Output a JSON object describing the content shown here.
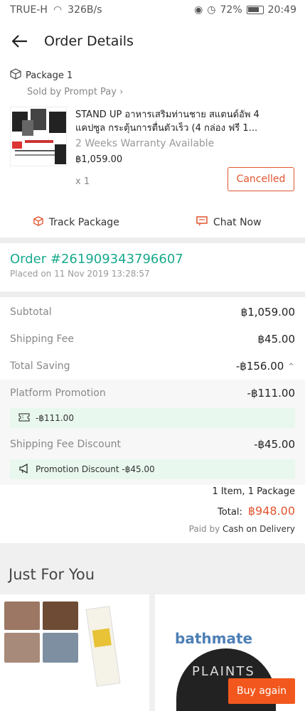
{
  "status": {
    "carrier": "TRUE-H",
    "speed": "326B/s",
    "battery": "72%",
    "time": "20:49"
  },
  "header": {
    "title": "Order Details"
  },
  "package": {
    "name": "Package 1",
    "sold_by": "Sold by Prompt Pay",
    "item_title": "STAND UP อาหารเสริมท่านชาย สแตนด์อัพ 4 แคปซูล กระตุ้นการตื่นตัวเร็ว (4 กล่อง ฟรี 1...",
    "warranty": "2 Weeks Warranty Available",
    "price": "฿1,059.00",
    "qty": "x 1",
    "status_label": "Cancelled",
    "track_label": "Track Package",
    "chat_label": "Chat Now"
  },
  "order": {
    "number": "Order #261909343796607",
    "placed": "Placed on 11 Nov 2019  13:28:57"
  },
  "summary": {
    "subtotal_label": "Subtotal",
    "subtotal_value": "฿1,059.00",
    "shipping_label": "Shipping Fee",
    "shipping_value": "฿45.00",
    "saving_label": "Total Saving",
    "saving_value": "-฿156.00",
    "platform_label": "Platform Promotion",
    "platform_value": "-฿111.00",
    "platform_chip": "-฿111.00",
    "ship_discount_label": "Shipping Fee Discount",
    "ship_discount_value": "-฿45.00",
    "ship_discount_chip": "Promotion Discount -฿45.00"
  },
  "totals": {
    "items": "1 Item, 1 Package",
    "total_label": "Total:",
    "total_value": "฿948.00",
    "paid_by": "Paid by",
    "payment_method": "Cash on Delivery"
  },
  "jfy": {
    "title": "Just For You",
    "card2_brand": "bathmate",
    "card2_text": "PLAINTS"
  },
  "buy_again": "Buy again",
  "colors": {
    "accent": "#e1552f",
    "order_green": "#19a98c",
    "chip_green": "#e9f8ef",
    "buy_again": "#f2581d"
  }
}
